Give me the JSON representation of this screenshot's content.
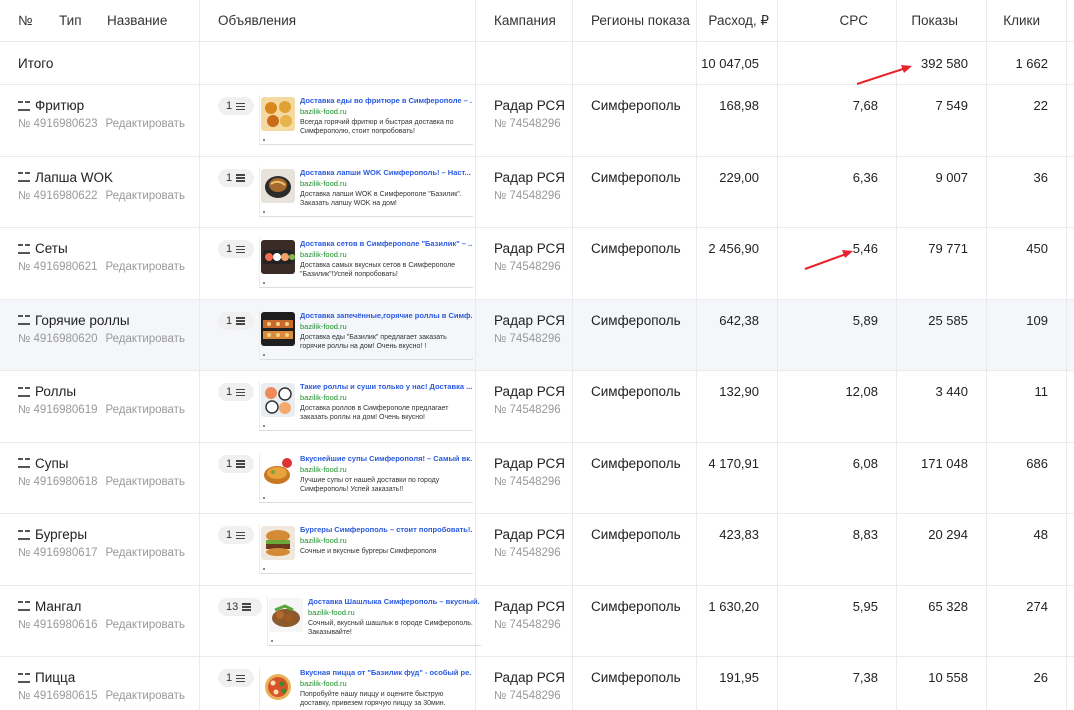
{
  "headers": {
    "num": "№",
    "type": "Тип",
    "name": "Название",
    "ads": "Объявления",
    "campaign": "Кампания",
    "regions": "Регионы показа",
    "cost": "Расход, ₽",
    "cpc": "CPC",
    "shows": "Показы",
    "clicks": "Клики"
  },
  "total": {
    "label": "Итого",
    "cost": "10 047,05",
    "shows": "392 580",
    "clicks": "1 662"
  },
  "edit_label": "Редактировать",
  "rows": [
    {
      "name": "Фритюр",
      "id": "№ 4916980623",
      "ads_count": "1",
      "ad_headline": "Доставка еды во фритюре в Симферополе – ...",
      "ad_domain": "bazilik-food.ru",
      "ad_body": "Всегда горячий фритюр и быстрая доставка по Симферополю, стоит попробовать!",
      "campaign": "Радар РСЯ",
      "campaign_id": "№ 74548296",
      "region": "Симферополь",
      "cost": "168,98",
      "cpc": "7,68",
      "shows": "7 549",
      "clicks": "22",
      "thumb": "food-thumb-fries"
    },
    {
      "name": "Лапша WOK",
      "id": "№ 4916980622",
      "ads_count": "1",
      "ad_headline": "Доставка лапши WOK Симферополь! – Наст...",
      "ad_domain": "bazilik-food.ru",
      "ad_body": "Доставка лапши WOK в Симферополе \"Базилик\". Заказать лапшу WOK на дом!",
      "campaign": "Радар РСЯ",
      "campaign_id": "№ 74548296",
      "region": "Симферополь",
      "cost": "229,00",
      "cpc": "6,36",
      "shows": "9 007",
      "clicks": "36",
      "thumb": "food-thumb-wok"
    },
    {
      "name": "Сеты",
      "id": "№ 4916980621",
      "ads_count": "1",
      "ad_headline": "Доставка сетов в Симферополе \"Базилик\" – ...",
      "ad_domain": "bazilik-food.ru",
      "ad_body": "Доставка самых вкусных сетов в Симферополе \"Базилик\"!Успей попробовать!",
      "campaign": "Радар РСЯ",
      "campaign_id": "№ 74548296",
      "region": "Симферополь",
      "cost": "2 456,90",
      "cpc": "5,46",
      "shows": "79 771",
      "clicks": "450",
      "thumb": "food-thumb-sets"
    },
    {
      "name": "Горячие роллы",
      "id": "№ 4916980620",
      "ads_count": "1",
      "ad_headline": "Доставка запечённые,горячие роллы в Симф...",
      "ad_domain": "bazilik-food.ru",
      "ad_body": "Доставка еды \"Базилик\" предлагает заказать горячие роллы на дом! Очень вкусно! !",
      "campaign": "Радар РСЯ",
      "campaign_id": "№ 74548296",
      "region": "Симферополь",
      "cost": "642,38",
      "cpc": "5,89",
      "shows": "25 585",
      "clicks": "109",
      "thumb": "food-thumb-hot-rolls"
    },
    {
      "name": "Роллы",
      "id": "№ 4916980619",
      "ads_count": "1",
      "ad_headline": "Такие роллы и суши только у нас! Доставка ...",
      "ad_domain": "bazilik-food.ru",
      "ad_body": "Доставка роллов в Симферополе предлагает заказать роллы на дом! Очень вкусно!",
      "campaign": "Радар РСЯ",
      "campaign_id": "№ 74548296",
      "region": "Симферополь",
      "cost": "132,90",
      "cpc": "12,08",
      "shows": "3 440",
      "clicks": "11",
      "thumb": "food-thumb-rolls"
    },
    {
      "name": "Супы",
      "id": "№ 4916980618",
      "ads_count": "1",
      "ad_headline": "Вкуснейшие супы Симферополя! – Самый вк...",
      "ad_domain": "bazilik-food.ru",
      "ad_body": "Лучшие супы от нашей доставки по городу Симферополь! Успей заказать!!",
      "campaign": "Радар РСЯ",
      "campaign_id": "№ 74548296",
      "region": "Симферополь",
      "cost": "4 170,91",
      "cpc": "6,08",
      "shows": "171 048",
      "clicks": "686",
      "thumb": "food-thumb-soup"
    },
    {
      "name": "Бургеры",
      "id": "№ 4916980617",
      "ads_count": "1",
      "ad_headline": "Бургеры Симферополь – стоит попробовать!...",
      "ad_domain": "bazilik-food.ru",
      "ad_body": "Сочные и вкусные бургеры Симферополя",
      "campaign": "Радар РСЯ",
      "campaign_id": "№ 74548296",
      "region": "Симферополь",
      "cost": "423,83",
      "cpc": "8,83",
      "shows": "20 294",
      "clicks": "48",
      "thumb": "food-thumb-burger"
    },
    {
      "name": "Мангал",
      "id": "№ 4916980616",
      "ads_count": "13",
      "ad_headline": "Доставка Шашлыка Симферополь – вкусный...",
      "ad_domain": "bazilik-food.ru",
      "ad_body": "Сочный, вкусный шашлык в городе Симферополь. Заказывайте!",
      "campaign": "Радар РСЯ",
      "campaign_id": "№ 74548296",
      "region": "Симферополь",
      "cost": "1 630,20",
      "cpc": "5,95",
      "shows": "65 328",
      "clicks": "274",
      "thumb": "food-thumb-grill"
    },
    {
      "name": "Пицца",
      "id": "№ 4916980615",
      "ads_count": "1",
      "ad_headline": "Вкусная пицца от \"Базилик фуд\" - особый ре...",
      "ad_domain": "bazilik-food.ru",
      "ad_body": "Попробуйте нашу пиццу и оцените быструю доставку, привезем горячую пиццу за 30мин.",
      "campaign": "Радар РСЯ",
      "campaign_id": "№ 74548296",
      "region": "Симферополь",
      "cost": "191,95",
      "cpc": "7,38",
      "shows": "10 558",
      "clicks": "26",
      "thumb": "food-thumb-pizza"
    }
  ],
  "colors": {
    "ad_headline": "#2a5adf",
    "ad_domain": "#1a8f2a",
    "arrow": "#e8222a",
    "row_highlight": "#f4f6fa"
  }
}
